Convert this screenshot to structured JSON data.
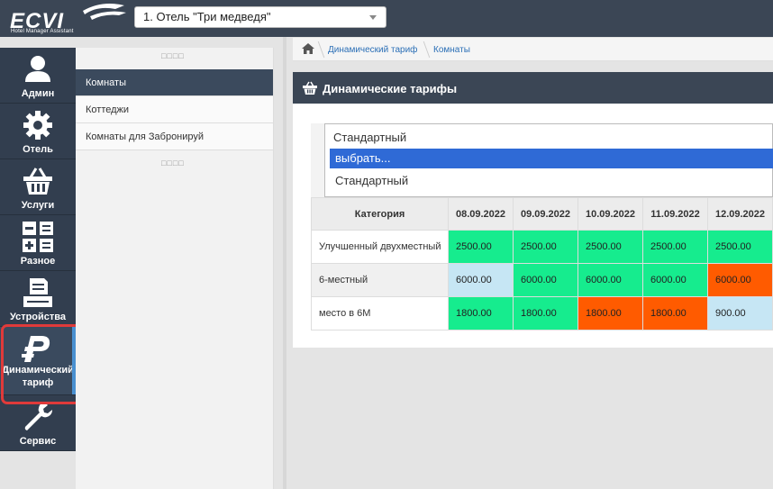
{
  "header": {
    "logo_text": "ECVI",
    "logo_subtitle": "Hotel Manager Assistant",
    "hotel_selected": "1. Отель \"Три медведя\""
  },
  "leftnav": [
    {
      "label": "Админ",
      "icon": "user-icon"
    },
    {
      "label": "Отель",
      "icon": "gear-icon"
    },
    {
      "label": "Услуги",
      "icon": "basket-icon"
    },
    {
      "label": "Разное",
      "icon": "calculator-icon"
    },
    {
      "label": "Устройства",
      "icon": "printer-icon"
    },
    {
      "label": "Динамический тариф",
      "label_line1": "Динамический",
      "label_line2": "тариф",
      "icon": "ruble-icon",
      "active": true
    },
    {
      "label": "Сервис",
      "icon": "wrench-icon"
    }
  ],
  "submenu": {
    "dots": "□□□□",
    "items": [
      {
        "label": "Комнаты",
        "active": true
      },
      {
        "label": "Коттеджи"
      },
      {
        "label": "Комнаты для Забронируй"
      }
    ]
  },
  "breadcrumb": [
    "Динамический тариф",
    "Комнаты"
  ],
  "panel": {
    "title": "Динамические тарифы"
  },
  "dropdown": {
    "current": "Стандартный",
    "options": [
      "выбрать...",
      "Стандартный"
    ],
    "highlighted": "выбрать..."
  },
  "table": {
    "header_category": "Категория",
    "dates": [
      "08.09.2022",
      "09.09.2022",
      "10.09.2022",
      "11.09.2022",
      "12.09.2022"
    ],
    "rows": [
      {
        "category": "Улучшенный двухместный",
        "values": [
          "2500.00",
          "2500.00",
          "2500.00",
          "2500.00",
          "2500.00"
        ],
        "colors": [
          "green",
          "green",
          "green",
          "green",
          "green"
        ]
      },
      {
        "category": "6-местный",
        "values": [
          "6000.00",
          "6000.00",
          "6000.00",
          "6000.00",
          "6000.00"
        ],
        "colors": [
          "blue",
          "green",
          "green",
          "green",
          "orange"
        ]
      },
      {
        "category": "место в 6М",
        "values": [
          "1800.00",
          "1800.00",
          "1800.00",
          "1800.00",
          "900.00"
        ],
        "colors": [
          "green",
          "green",
          "orange",
          "orange",
          "blue"
        ]
      }
    ]
  },
  "colors": {
    "header_bg": "#3b4655",
    "nav_bg": "#323e4f",
    "green": "#16ec8e",
    "blue": "#c6e6f4",
    "orange": "#ff5b00",
    "highlight": "#e03a3a",
    "select_blue": "#2f6ad6"
  }
}
